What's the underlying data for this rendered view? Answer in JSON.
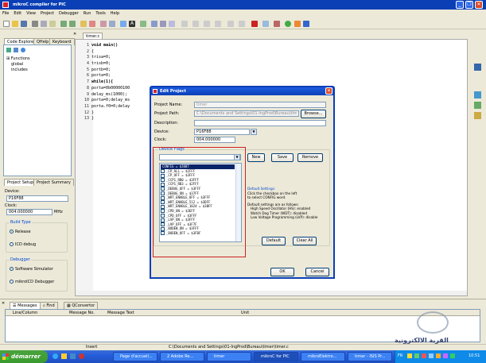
{
  "window": {
    "title": "mikroC compiler for PIC"
  },
  "menu": [
    "File",
    "Edit",
    "View",
    "Project",
    "Debugger",
    "Run",
    "Tools",
    "Help"
  ],
  "left_tabs": [
    "Code Explorer",
    "QHelp",
    "Keyboard"
  ],
  "tree": [
    "Functions",
    "global",
    "includes"
  ],
  "setup_tabs": [
    "Project Setup",
    "Project Summary"
  ],
  "setup": {
    "device_label": "Device:",
    "device": "P16F88",
    "clock_label": "Clock:",
    "clock": "004.000000",
    "clock_unit": "MHz",
    "build_type_label": "Build Type",
    "release": "Release",
    "icd_debug": "ICD debug",
    "debugger_label": "Debugger",
    "software_sim": "Software Simulator",
    "mikroicd": "mikroICD Debugger"
  },
  "editor": {
    "tab": "timer.c",
    "lines": [
      {
        "n": "1",
        "t": "void main()"
      },
      {
        "n": "2",
        "t": "{"
      },
      {
        "n": "3",
        "t": "trisa=0;"
      },
      {
        "n": "4",
        "t": "trisb=0;"
      },
      {
        "n": "5",
        "t": "portb=0;"
      },
      {
        "n": "6",
        "t": "porta=0;"
      },
      {
        "n": "7",
        "t": "while(1){"
      },
      {
        "n": "8",
        "t": "porta=0b00000100"
      },
      {
        "n": "9",
        "t": "delay_ms(1000);"
      },
      {
        "n": "10",
        "t": "porta=0;delay_ms"
      },
      {
        "n": "11",
        "t": "porta.f0=0;delay"
      },
      {
        "n": "12",
        "t": "}"
      },
      {
        "n": "13",
        "t": "}"
      }
    ]
  },
  "dialog": {
    "title": "Edit Project",
    "project_name_label": "Project Name:",
    "project_name": "timer",
    "project_path_label": "Project Path:",
    "project_path": "C:\\Documents and Settings\\01-IngProd\\Bureau\\timer\\",
    "browse": "Browse...",
    "description_label": "Description:",
    "description": "",
    "device_label": "Device:",
    "device": "P16F88",
    "clock_label": "Clock:",
    "clock": "004.000000",
    "device_flags_label": "Device Flags",
    "new": "New",
    "save": "Save",
    "remove": "Remove",
    "flags": [
      {
        "label": "CONFIG = $2007",
        "checked": false,
        "header": true
      },
      {
        "label": "_CP_ALL = $1FFF",
        "checked": false
      },
      {
        "label": "_CP_OFF = $3FFF",
        "checked": false
      },
      {
        "label": "_CCP1_RB0 = $3FFF",
        "checked": false
      },
      {
        "label": "_CCP1_RB3 = $2FFF",
        "checked": false
      },
      {
        "label": "_DEBUG_OFF = $3FFF",
        "checked": false
      },
      {
        "label": "_DEBUG_ON = $37FF",
        "checked": false
      },
      {
        "label": "_WRT_ENABLE_OFF = $3FFF",
        "checked": false
      },
      {
        "label": "_WRT_ENABLE_512 = $3DFF",
        "checked": false
      },
      {
        "label": "_WRT_ENABLE_1024 = $3BFF",
        "checked": false
      },
      {
        "label": "_CPD_ON = $3EFF",
        "checked": false
      },
      {
        "label": "_CPD_OFF = $3FFF",
        "checked": false
      },
      {
        "label": "_LVP_ON = $3FFF",
        "checked": false
      },
      {
        "label": "_LVP_OFF = $3F7F",
        "checked": true
      },
      {
        "label": "_BODEN_ON = $3FFF",
        "checked": false
      },
      {
        "label": "_BODEN_OFF = $3FBF",
        "checked": false
      }
    ],
    "defaults_title": "Default Settings:",
    "defaults_hint1": "Click the checkbox on the left",
    "defaults_hint2": "to select CONFIG word.",
    "defaults_info": "Default settings are as follows:",
    "default_osc": "High Speed Oscillator (HS): enabled",
    "default_wdt": "Watch Dog Timer (WDT): disabled",
    "default_lvp": "Low Voltage Programming (LVP): disable",
    "default_btn": "Default",
    "clear_all": "Clear All",
    "ok": "OK",
    "cancel": "Cancel"
  },
  "messages": {
    "tabs": [
      "Messages",
      "Find",
      "QConvertor"
    ],
    "columns": [
      "Line/Column",
      "Message No.",
      "Message Text",
      "Unit"
    ]
  },
  "status": {
    "mode": "Insert",
    "path": "C:\\Documents and Settings\\01-IngProd\\Bureau\\timer\\timer.c"
  },
  "taskbar": {
    "start": "démarrer",
    "tasks": [
      "Page d'accueil...",
      "2 Adobe Re...",
      "timer",
      "mikroC for PIC",
      "mikroElektro...",
      "timer - ISIS Pr..."
    ],
    "lang": "FR",
    "clock": "10:51"
  },
  "watermark": "القرية الالكترونية",
  "colors": {
    "title_blue": "#0a3fb6",
    "dialog_red_highlight": "#cc2222",
    "taskbar_blue": "#245ddb",
    "start_green": "#3a9a2f"
  }
}
